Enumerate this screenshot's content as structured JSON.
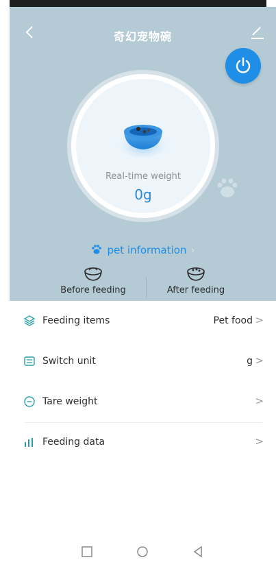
{
  "header": {
    "title": "奇幻宠物碗"
  },
  "scale": {
    "realtime_label": "Real-time weight",
    "realtime_value": "0g"
  },
  "pet_info": {
    "label": "pet information"
  },
  "feeding": {
    "before_label": "Before feeding",
    "after_label": "After feeding"
  },
  "menu": [
    {
      "label": "Feeding items",
      "value": "Pet food",
      "icon": "layers-icon"
    },
    {
      "label": "Switch unit",
      "value": "g",
      "icon": "unit-icon"
    },
    {
      "label": "Tare weight",
      "value": "",
      "icon": "minus-circle-icon"
    },
    {
      "label": "Feeding data",
      "value": "",
      "icon": "bar-chart-icon"
    }
  ],
  "colors": {
    "hero_bg": "#b4cad5",
    "accent": "#1f8ee6",
    "text": "#2f2f2f"
  }
}
